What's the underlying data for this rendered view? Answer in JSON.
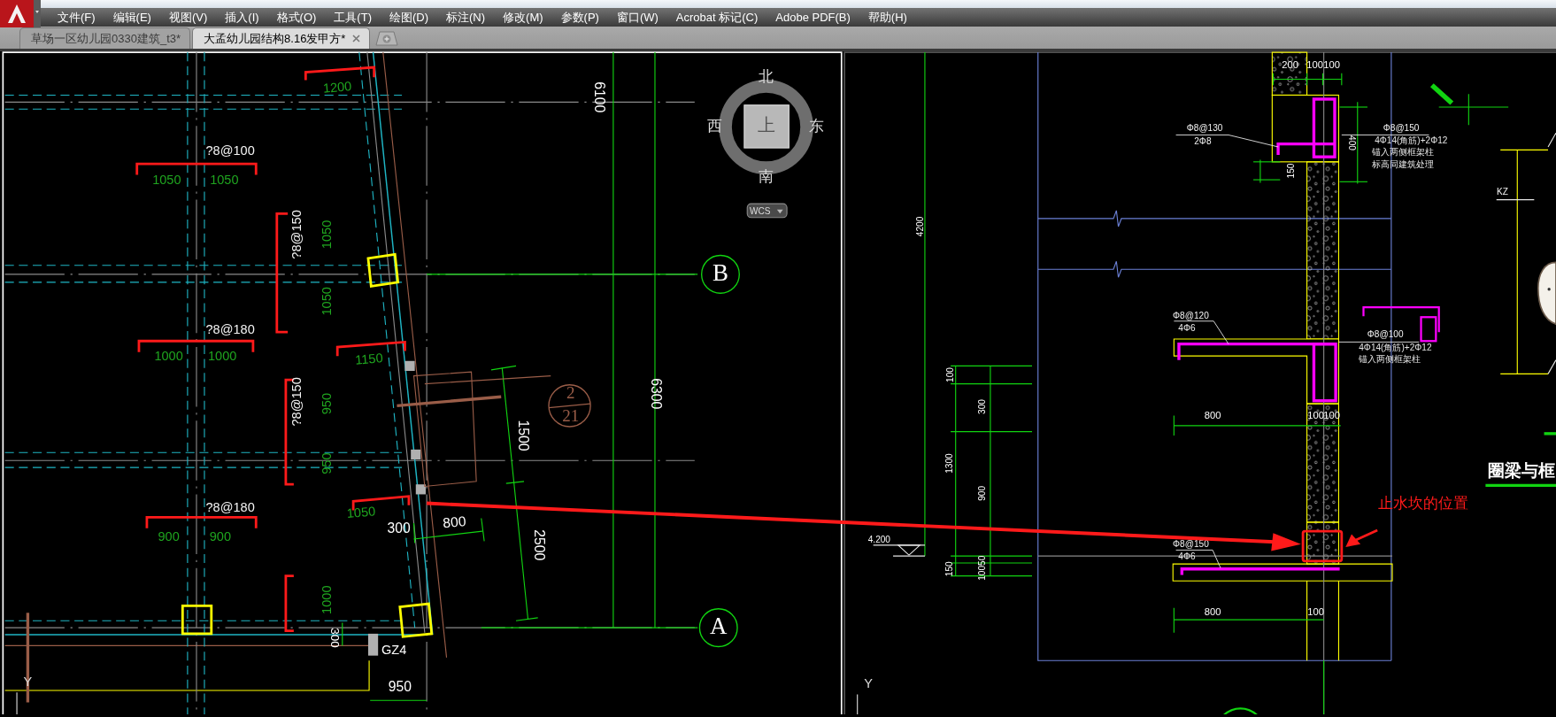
{
  "menu": [
    "文件(F)",
    "编辑(E)",
    "视图(V)",
    "插入(I)",
    "格式(O)",
    "工具(T)",
    "绘图(D)",
    "标注(N)",
    "修改(M)",
    "参数(P)",
    "窗口(W)",
    "Acrobat 标记(C)",
    "Adobe PDF(B)",
    "帮助(H)"
  ],
  "tabs": [
    {
      "label": "草场一区幼儿园0330建筑_t3*",
      "selected": false
    },
    {
      "label": "大孟幼儿园结构8.16发甲方*",
      "selected": true
    }
  ],
  "left_view": {
    "active": true,
    "viewcube": {
      "north": "北",
      "south": "南",
      "west": "西",
      "east": "东",
      "face": "上",
      "coordinate_system": "WCS"
    },
    "grid_bubbles": [
      "B",
      "A"
    ],
    "detail_bubble": {
      "number": "2",
      "sheet": "21"
    },
    "labels": [
      {
        "text": "1200",
        "kind": "span"
      },
      {
        "text": "?8@100",
        "kind": "rebar"
      },
      {
        "text": "1050",
        "kind": "span"
      },
      {
        "text": "1050",
        "kind": "span"
      },
      {
        "text": "?8@150",
        "kind": "rebar"
      },
      {
        "text": "1050",
        "kind": "span"
      },
      {
        "text": "1050",
        "kind": "span"
      },
      {
        "text": "?8@180",
        "kind": "rebar"
      },
      {
        "text": "1000",
        "kind": "span"
      },
      {
        "text": "1000",
        "kind": "span"
      },
      {
        "text": "1150",
        "kind": "span"
      },
      {
        "text": "?8@150",
        "kind": "rebar"
      },
      {
        "text": "950",
        "kind": "span"
      },
      {
        "text": "950",
        "kind": "span"
      },
      {
        "text": "?8@180",
        "kind": "rebar"
      },
      {
        "text": "900",
        "kind": "span"
      },
      {
        "text": "900",
        "kind": "span"
      },
      {
        "text": "1050",
        "kind": "span"
      },
      {
        "text": "300",
        "kind": "dimension"
      },
      {
        "text": "800",
        "kind": "dimension"
      },
      {
        "text": "1500",
        "kind": "dimension"
      },
      {
        "text": "2500",
        "kind": "dimension"
      },
      {
        "text": "6300",
        "kind": "dimension"
      },
      {
        "text": "6100",
        "kind": "dimension"
      },
      {
        "text": "1000",
        "kind": "span"
      },
      {
        "text": "300",
        "kind": "dimension"
      },
      {
        "text": "GZ4",
        "kind": "dimension"
      },
      {
        "text": "950",
        "kind": "dimension"
      }
    ],
    "ucs_axis": "Y"
  },
  "right_view": {
    "active": false,
    "labels": [
      {
        "text": "200",
        "kind": "dimension"
      },
      {
        "text": "100",
        "kind": "dimension"
      },
      {
        "text": "100",
        "kind": "dimension"
      },
      {
        "text": "4200",
        "kind": "dimension"
      },
      {
        "text": "Φ8@130",
        "kind": "rebar"
      },
      {
        "text": "2Φ8",
        "kind": "rebar"
      },
      {
        "text": "400",
        "kind": "dimension"
      },
      {
        "text": "150",
        "kind": "dimension"
      },
      {
        "text": "Φ8@150",
        "kind": "rebar"
      },
      {
        "text": "4Φ14(角筋)+2Φ12",
        "kind": "note"
      },
      {
        "text": "锚入两侧框架柱",
        "kind": "note"
      },
      {
        "text": "标高同建筑处理",
        "kind": "note"
      },
      {
        "text": "KZ",
        "kind": "rebar"
      },
      {
        "text": "Φ8@120",
        "kind": "rebar"
      },
      {
        "text": "4Φ6",
        "kind": "rebar"
      },
      {
        "text": "Φ8@100",
        "kind": "rebar"
      },
      {
        "text": "4Φ14(角筋)+2Φ12",
        "kind": "note"
      },
      {
        "text": "锚入两侧框架柱",
        "kind": "note"
      },
      {
        "text": "100",
        "kind": "dimension"
      },
      {
        "text": "300",
        "kind": "dimension"
      },
      {
        "text": "1300",
        "kind": "dimension"
      },
      {
        "text": "900",
        "kind": "dimension"
      },
      {
        "text": "800",
        "kind": "dimension"
      },
      {
        "text": "100",
        "kind": "dimension"
      },
      {
        "text": "100",
        "kind": "dimension"
      },
      {
        "text": "4.200",
        "kind": "level"
      },
      {
        "text": "Φ8@150",
        "kind": "rebar"
      },
      {
        "text": "4Φ6",
        "kind": "rebar"
      },
      {
        "text": "150",
        "kind": "dimension"
      },
      {
        "text": "10050",
        "kind": "dimension"
      },
      {
        "text": "800",
        "kind": "dimension"
      },
      {
        "text": "100",
        "kind": "dimension"
      }
    ],
    "annotation": "止水坎的位置",
    "heading": "圈梁与框",
    "ucs_axis": "Y"
  }
}
